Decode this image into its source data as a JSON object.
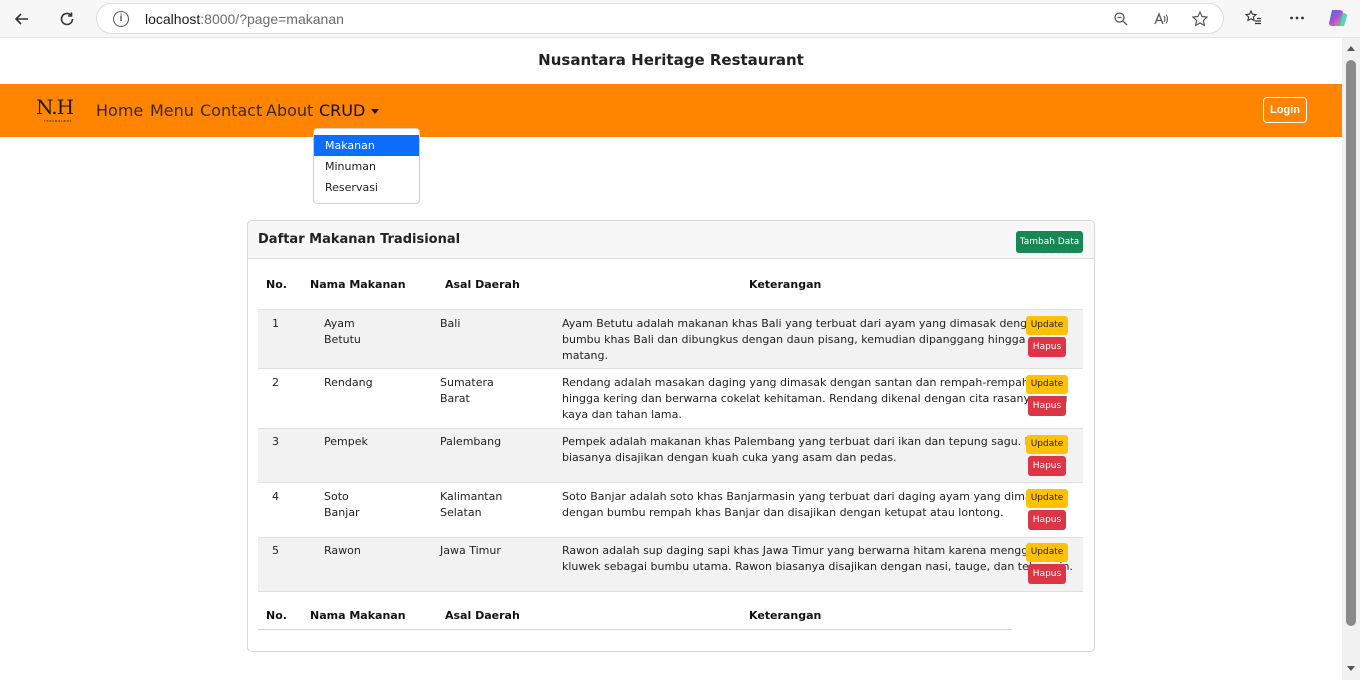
{
  "browser": {
    "url_host": "localhost",
    "url_rest": ":8000/?page=makanan"
  },
  "site": {
    "title": "Nusantara Heritage Restaurant",
    "logo_text": "N.H",
    "logo_sub": "restaurant"
  },
  "nav": {
    "items": [
      "Home",
      "Menu",
      "Contact",
      "About",
      "CRUD"
    ],
    "login": "Login"
  },
  "dropdown": {
    "items": [
      "Makanan",
      "Minuman",
      "Reservasi"
    ],
    "selected": "Makanan"
  },
  "card": {
    "title": "Daftar Makanan Tradisional",
    "add_button": "Tambah Data"
  },
  "table": {
    "headers": [
      "No.",
      "Nama Makanan",
      "Asal Daerah",
      "Keterangan"
    ],
    "update_label": "Update",
    "delete_label": "Hapus",
    "rows": [
      {
        "no": "1",
        "nama": [
          "Ayam",
          "Betutu"
        ],
        "asal": [
          "Bali"
        ],
        "ket": [
          "Ayam Betutu adalah makanan khas Bali yang terbuat dari ayam yang dimasak dengan",
          "bumbu khas Bali dan dibungkus dengan daun pisang, kemudian dipanggang hingga",
          "matang."
        ]
      },
      {
        "no": "2",
        "nama": [
          "Rendang"
        ],
        "asal": [
          "Sumatera",
          "Barat"
        ],
        "ket": [
          "Rendang adalah masakan daging yang dimasak dengan santan dan rempah-rempah",
          "hingga kering dan berwarna cokelat kehitaman. Rendang dikenal dengan cita rasanya yang",
          "kaya dan tahan lama."
        ]
      },
      {
        "no": "3",
        "nama": [
          "Pempek"
        ],
        "asal": [
          "Palembang"
        ],
        "ket": [
          "Pempek adalah makanan khas Palembang yang terbuat dari ikan dan tepung sagu. Pempek",
          "biasanya disajikan dengan kuah cuka yang asam dan pedas."
        ]
      },
      {
        "no": "4",
        "nama": [
          "Soto",
          "Banjar"
        ],
        "asal": [
          "Kalimantan",
          "Selatan"
        ],
        "ket": [
          "Soto Banjar adalah soto khas Banjarmasin yang terbuat dari daging ayam yang dimasak",
          "dengan bumbu rempah khas Banjar dan disajikan dengan ketupat atau lontong."
        ]
      },
      {
        "no": "5",
        "nama": [
          "Rawon"
        ],
        "asal": [
          "Jawa Timur"
        ],
        "ket": [
          "Rawon adalah sup daging sapi khas Jawa Timur yang berwarna hitam karena menggunakan",
          "kluwek sebagai bumbu utama. Rawon biasanya disajikan dengan nasi, tauge, dan telur asin."
        ]
      }
    ]
  },
  "colors": {
    "navbar": "#ff8400",
    "add_button": "#198754",
    "update_button": "#ffc107",
    "delete_button": "#dc3545",
    "dropdown_selected": "#0d6efd"
  }
}
